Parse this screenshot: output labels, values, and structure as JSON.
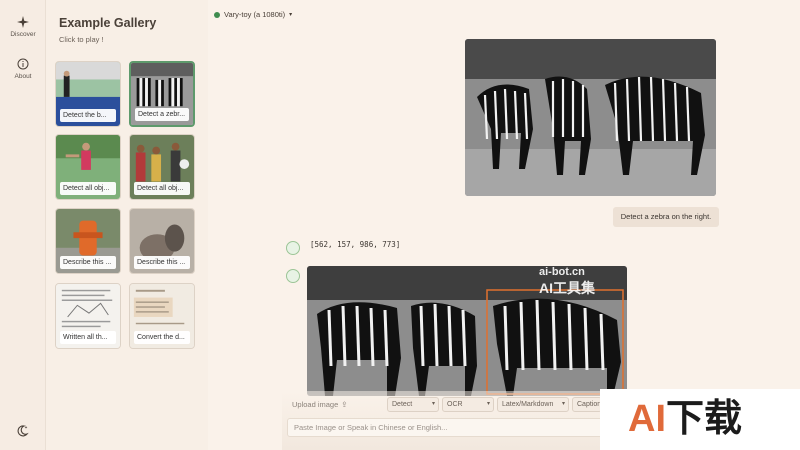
{
  "rail": {
    "discover_label": "Discover",
    "about_label": "About"
  },
  "gallery": {
    "title": "Example Gallery",
    "subtitle": "Click to play !",
    "items": [
      {
        "caption": "Detect the b..."
      },
      {
        "caption": "Detect a zebr..."
      },
      {
        "caption": "Detect all obj..."
      },
      {
        "caption": "Detect all obj..."
      },
      {
        "caption": "Describe this ..."
      },
      {
        "caption": "Describe this ..."
      },
      {
        "caption": "Written all th..."
      },
      {
        "caption": "Convert the d..."
      }
    ]
  },
  "header": {
    "model_label": "Vary-toy (a 1080ti)",
    "status_color": "#3f8c4f"
  },
  "chat": {
    "user_message": "Detect a zebra on the right.",
    "bot_reply": "[562, 157, 986, 773]"
  },
  "composer": {
    "upload_label": "Upload image",
    "chips": [
      "Detect",
      "OCR",
      "Latex/Markdown",
      "Caption"
    ],
    "input_placeholder": "Paste Image or Speak in Chinese or English..."
  },
  "watermarks": {
    "ai_bot_url": "ai-bot.cn",
    "ai_bot_name": "AI工具集",
    "ai_download_brand_a": "AI",
    "ai_download_brand_b": "下载"
  },
  "colors": {
    "accent_green": "#3f8c4f",
    "selection_border": "#5e9a6c",
    "bbox_color": "#e0702f"
  }
}
